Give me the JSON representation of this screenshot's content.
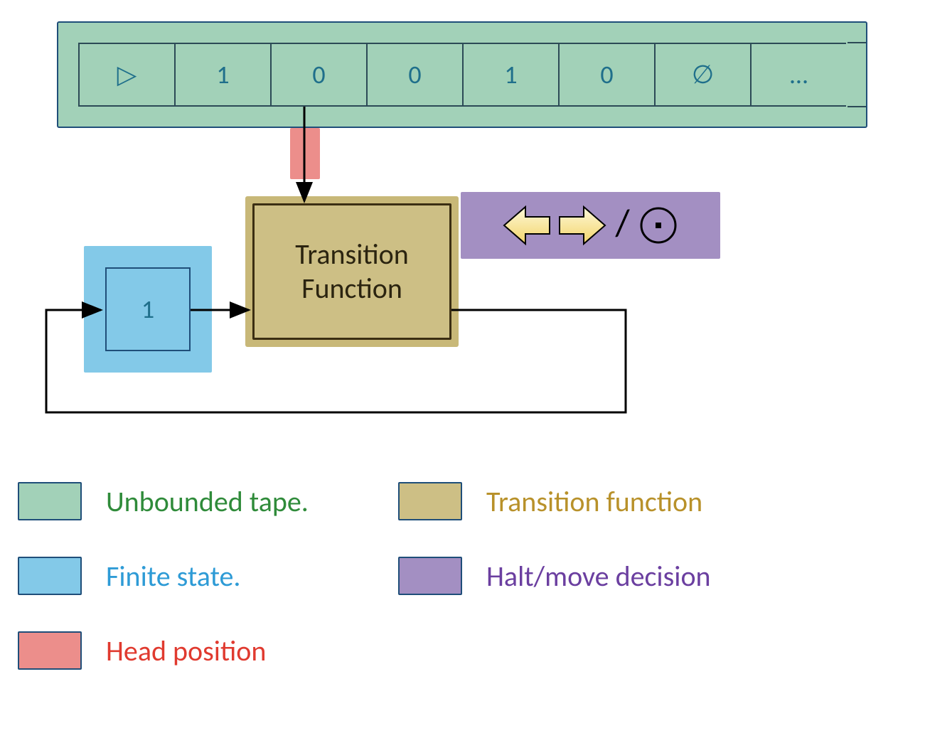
{
  "tape": {
    "cells": [
      "▷",
      "1",
      "0",
      "0",
      "1",
      "0",
      "∅",
      "…"
    ]
  },
  "state": {
    "value": "1"
  },
  "transition_function": {
    "line1": "Transition",
    "line2": "Function"
  },
  "halt_move": {
    "slash": "/"
  },
  "legend": {
    "tape": {
      "label": "Unbounded tape.",
      "swatch": "#a2d1b8",
      "text_color": "#2f8b3a"
    },
    "state": {
      "label": "Finite state.",
      "swatch": "#83c9e8",
      "text_color": "#2e9bd6"
    },
    "head": {
      "label": "Head position",
      "swatch": "#ec8e8b",
      "text_color": "#e03a2f"
    },
    "tf": {
      "label": "Transition function",
      "swatch": "#cdbf85",
      "text_color": "#b8912a"
    },
    "hm": {
      "label": "Halt/move decision",
      "swatch": "#a38fc2",
      "text_color": "#6b3fa0"
    }
  },
  "colors": {
    "tape_bg": "#a2d1b8",
    "state_bg": "#83c9e8",
    "head_bg": "#ec8e8b",
    "tf_bg": "#cdbf85",
    "hm_bg": "#a38fc2",
    "border_blue": "#1f4e79",
    "tape_text": "#1f6f8b"
  }
}
